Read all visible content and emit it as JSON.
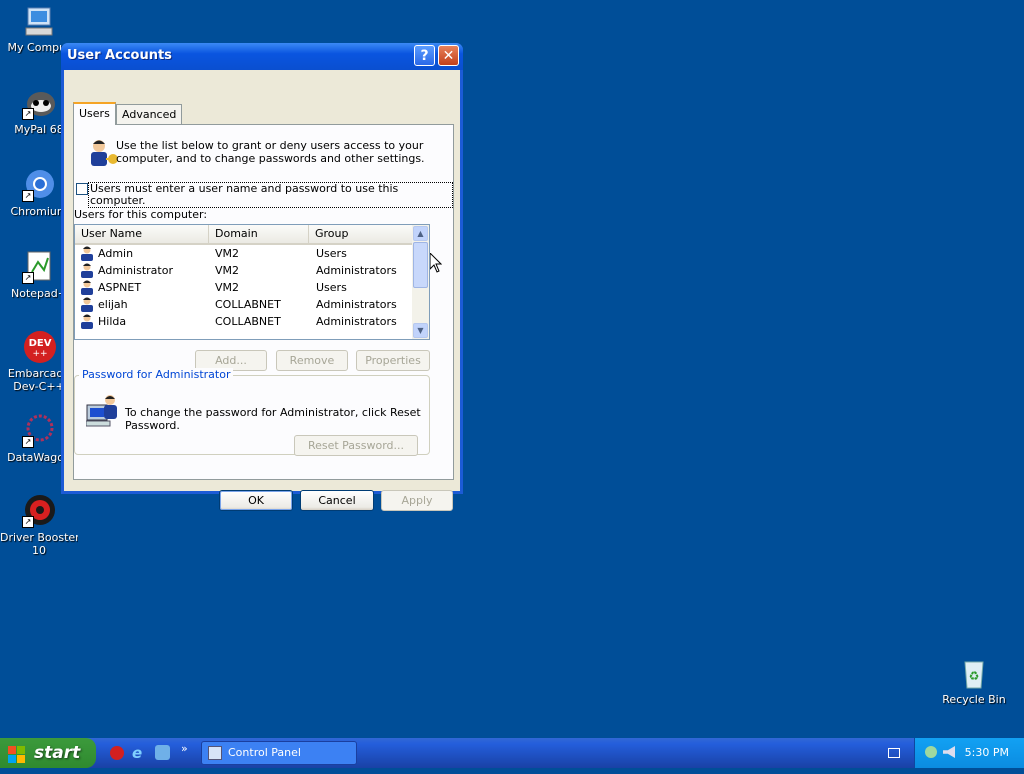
{
  "desktop": {
    "icons": [
      {
        "label": "My Comput",
        "icon": "my-computer-icon"
      },
      {
        "label": "MyPal 68",
        "icon": "mypal-icon"
      },
      {
        "label": "Chromium",
        "icon": "chromium-icon"
      },
      {
        "label": "Notepad+",
        "icon": "notepad-plus-icon"
      },
      {
        "label": "Embarcade Dev-C++",
        "line1": "Embarcade",
        "line2": "Dev-C++",
        "icon": "devcpp-icon"
      },
      {
        "label": "DataWagon",
        "icon": "datawagon-icon"
      },
      {
        "label": "Driver Booster 10",
        "line1": "Driver Booster",
        "line2": "10",
        "icon": "driver-booster-icon"
      },
      {
        "label": "Recycle Bin",
        "icon": "recycle-bin-icon"
      }
    ]
  },
  "window": {
    "title": "User Accounts",
    "help_label": "?",
    "close_label": "✕",
    "tabs": [
      {
        "label": "Users",
        "active": true
      },
      {
        "label": "Advanced",
        "active": false
      }
    ],
    "intro_line1": "Use the list below to grant or deny users access to your",
    "intro_line2": "computer, and to change passwords and other settings.",
    "checkbox_label": "Users must enter a user name and password to use this computer.",
    "checkbox_checked": false,
    "list_caption": "Users for this computer:",
    "columns": [
      "User Name",
      "Domain",
      "Group"
    ],
    "users": [
      {
        "name": "Admin",
        "domain": "VM2",
        "group": "Users"
      },
      {
        "name": "Administrator",
        "domain": "VM2",
        "group": "Administrators"
      },
      {
        "name": "ASPNET",
        "domain": "VM2",
        "group": "Users"
      },
      {
        "name": "elijah",
        "domain": "COLLABNET",
        "group": "Administrators"
      },
      {
        "name": "Hilda",
        "domain": "COLLABNET",
        "group": "Administrators"
      }
    ],
    "buttons": {
      "add": "Add...",
      "remove": "Remove",
      "properties": "Properties"
    },
    "password_group_title": "Password for Administrator",
    "password_line1": "To change the password for Administrator, click Reset",
    "password_line2": "Password.",
    "reset_password": "Reset Password...",
    "ok": "OK",
    "cancel": "Cancel",
    "apply": "Apply"
  },
  "taskbar": {
    "start_label": "start",
    "task_label": "Control Panel",
    "clock": "5:30 PM"
  },
  "colors": {
    "desktop": "#004e98",
    "title_bar": "#0a55e0",
    "dialog": "#ece9d8",
    "group_title": "#0046d5"
  }
}
